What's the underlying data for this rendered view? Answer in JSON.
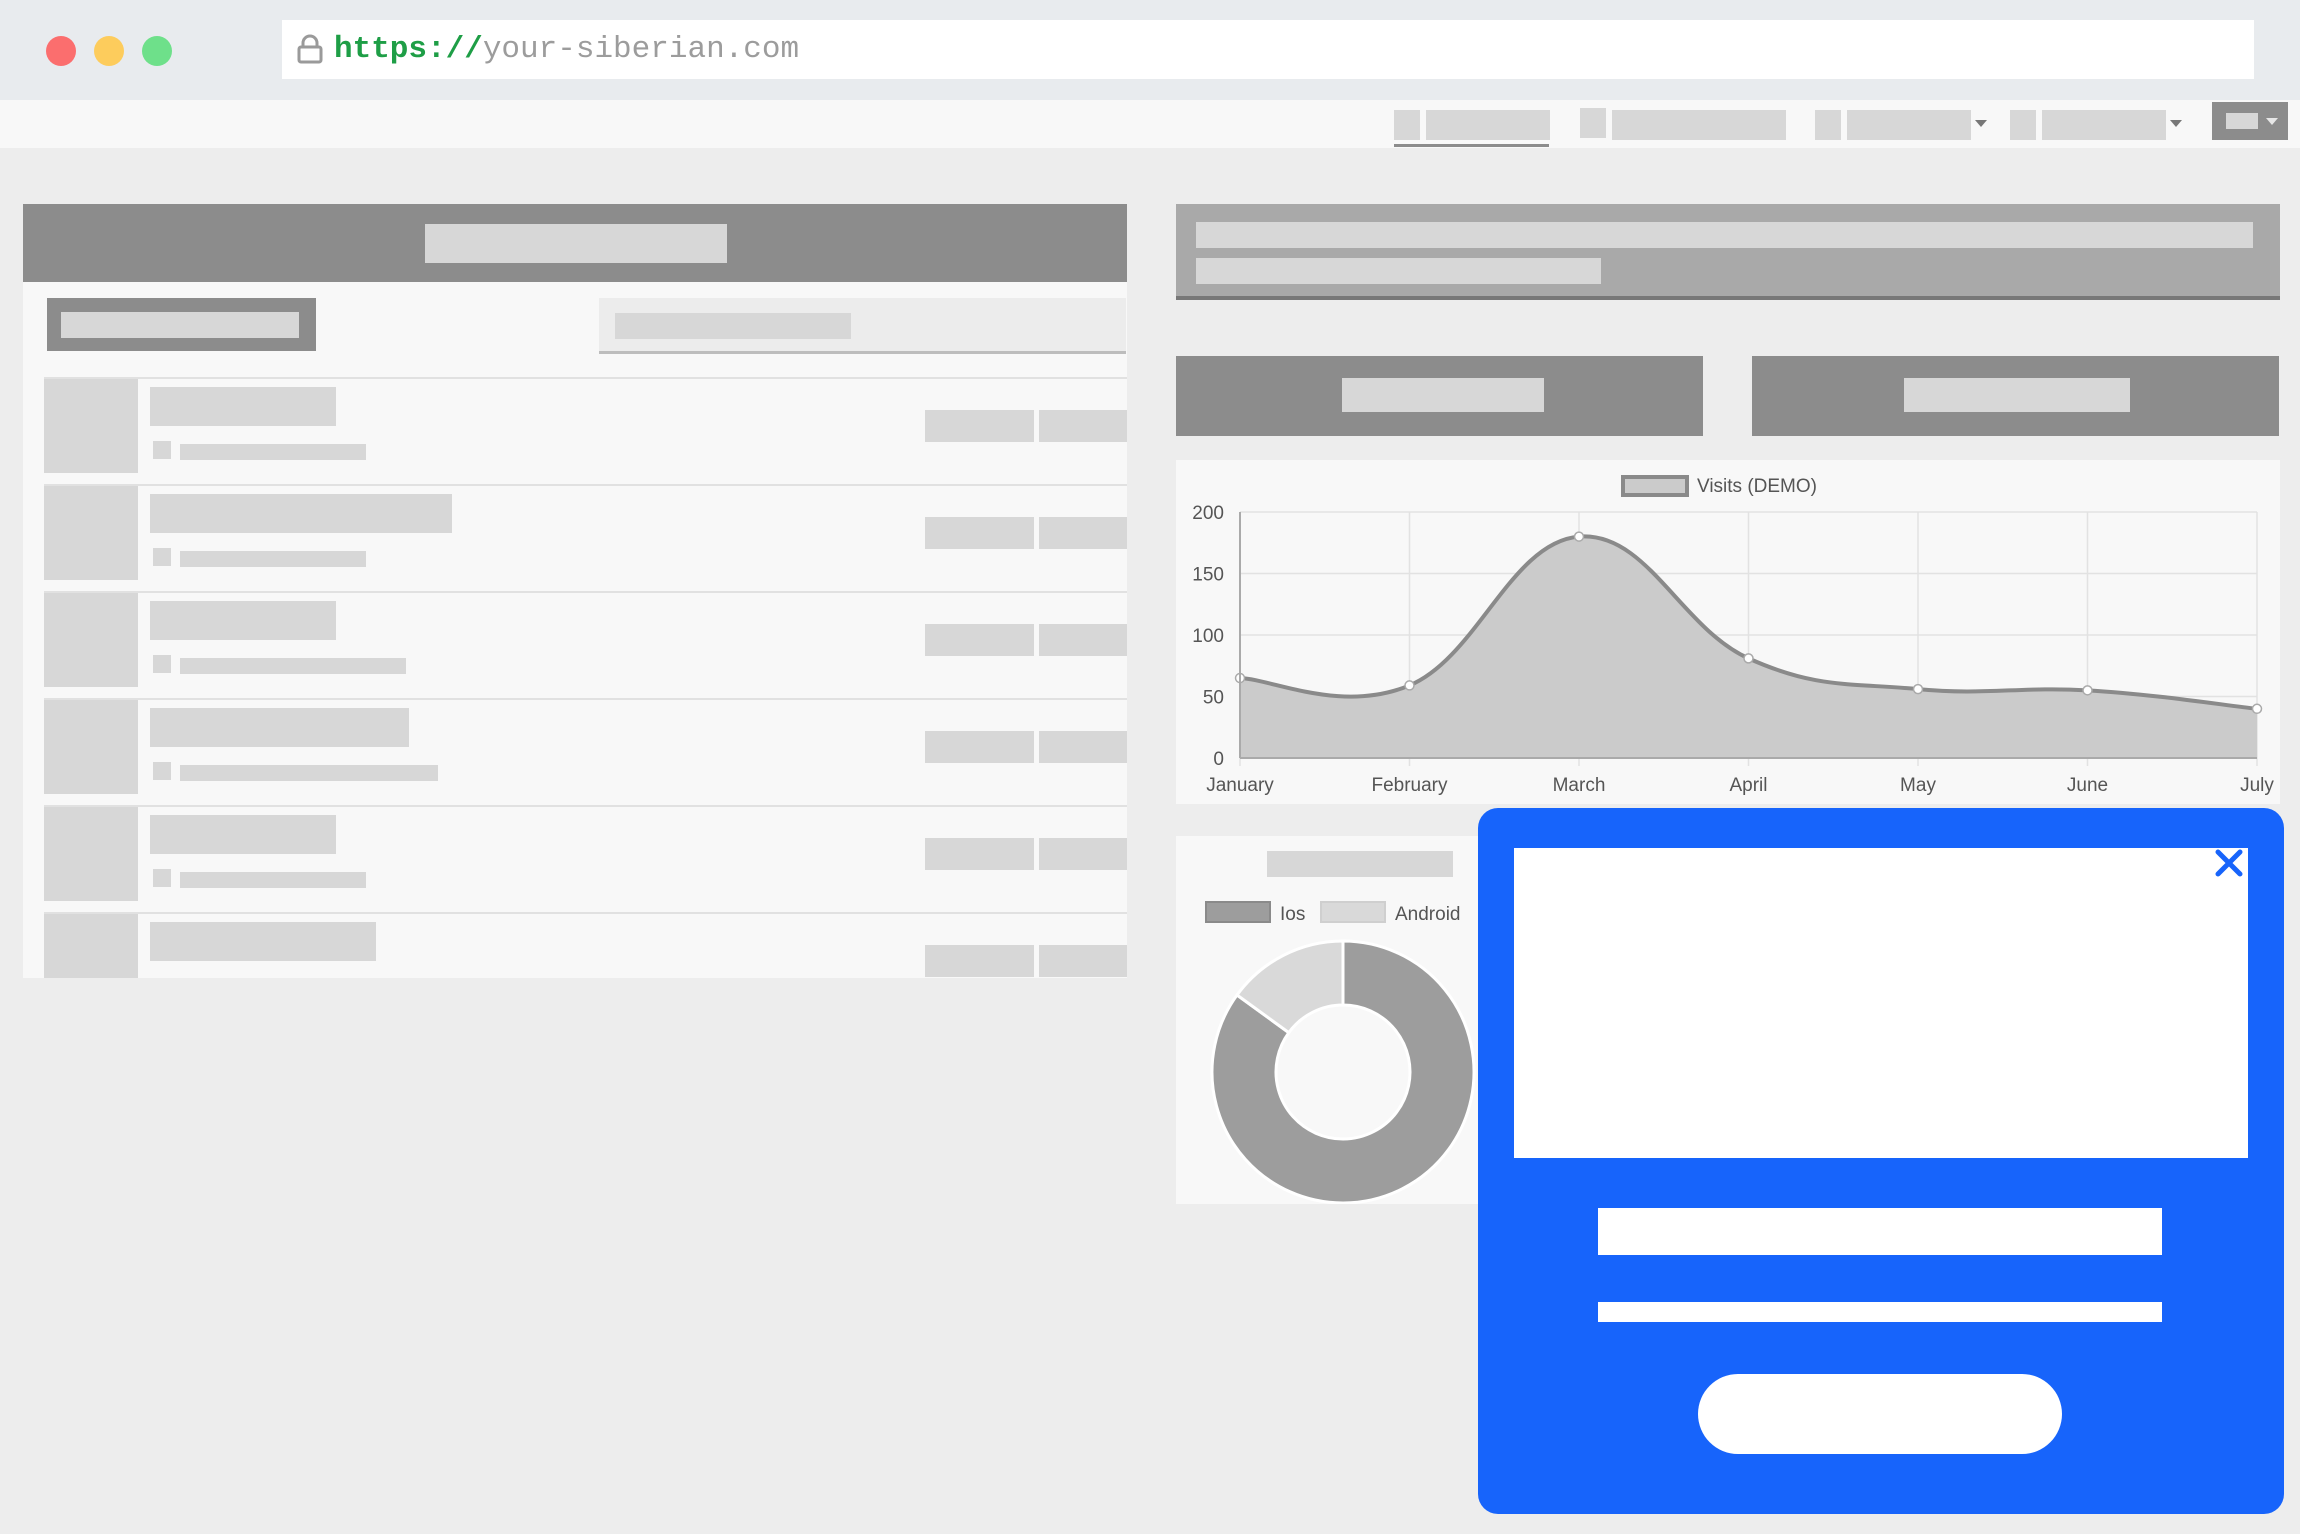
{
  "browser": {
    "url_scheme": "https://",
    "url_host": "your-siberian.com",
    "traffic_light_colors": [
      "#fb6e6e",
      "#fdcc5c",
      "#6ee08a"
    ]
  },
  "colors": {
    "placeholder": "#d7d7d7",
    "header_gray": "#8c8c8c",
    "popup_blue": "#1764fb",
    "chart_line": "#8a8a8a",
    "chart_fill": "#cbcbcb",
    "donut_ios": "#9d9d9d",
    "donut_android": "#d9d9d9"
  },
  "navigation": {
    "items": [
      {
        "icon": "nav-placeholder-icon",
        "has_caret": false,
        "active": true
      },
      {
        "icon": "nav-placeholder-icon",
        "has_caret": false,
        "active": false
      },
      {
        "icon": "nav-placeholder-icon",
        "has_caret": true,
        "active": false
      },
      {
        "icon": "nav-placeholder-icon",
        "has_caret": true,
        "active": false
      }
    ],
    "user_menu_icon": "user-menu-icon"
  },
  "list": {
    "row_count": 6
  },
  "chart_data": [
    {
      "type": "line",
      "style": "smoothed area",
      "legend": [
        "Visits (DEMO)"
      ],
      "legend_position": "top",
      "categories": [
        "January",
        "February",
        "March",
        "April",
        "May",
        "June",
        "July"
      ],
      "series": [
        {
          "name": "Visits (DEMO)",
          "values": [
            65,
            59,
            180,
            81,
            56,
            55,
            40
          ]
        }
      ],
      "ylim": [
        0,
        200
      ],
      "yticks": [
        0,
        50,
        100,
        150,
        200
      ],
      "grid": true
    },
    {
      "type": "pie",
      "style": "doughnut",
      "legend": [
        "Ios",
        "Android"
      ],
      "legend_position": "top",
      "values": [
        85,
        15
      ]
    }
  ],
  "popup": {
    "close_icon": "close-icon"
  }
}
